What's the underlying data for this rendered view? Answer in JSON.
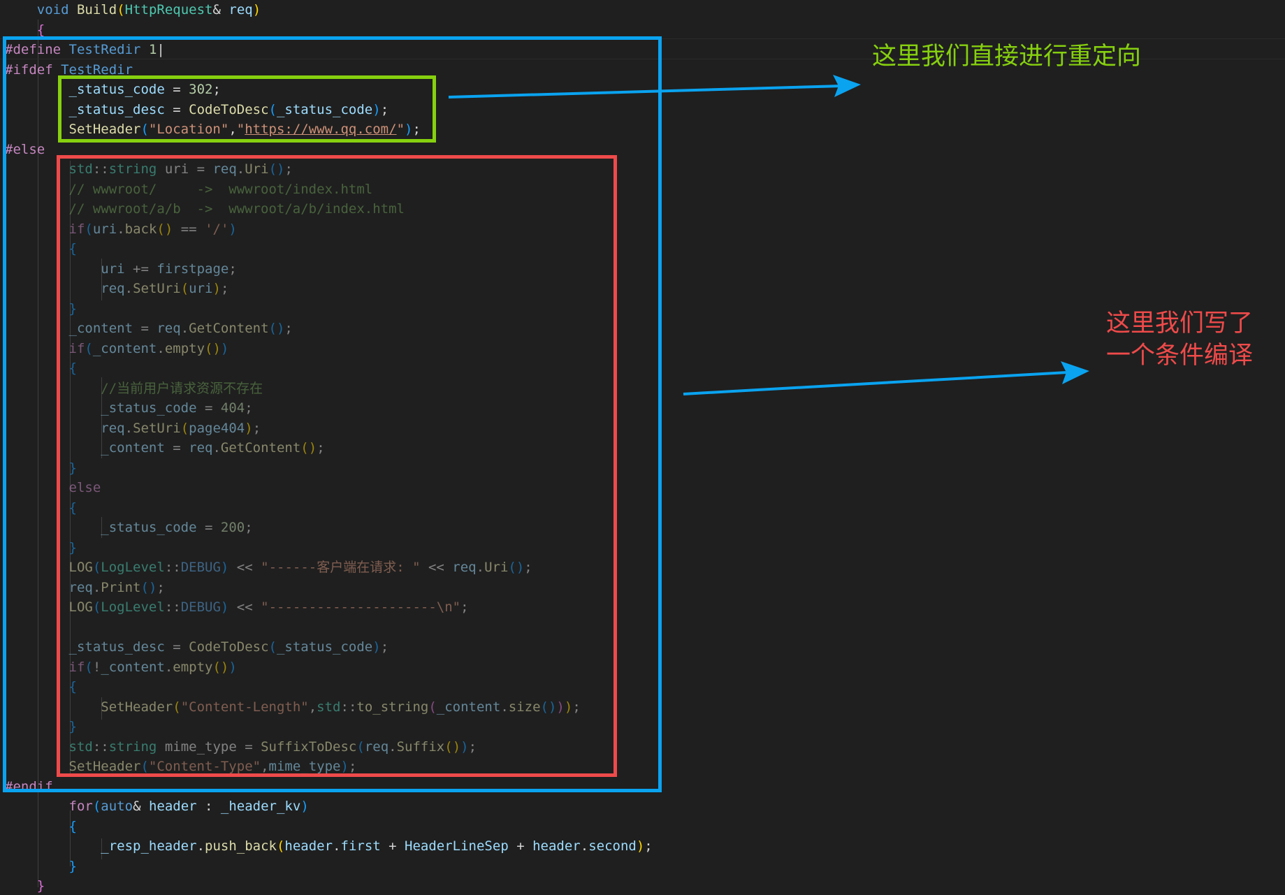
{
  "colors": {
    "annotation_blue": "#0aa3f0",
    "annotation_green": "#86d00f",
    "annotation_red": "#ef4a4a",
    "background": "#1f1f1f"
  },
  "annotations": {
    "green_note": "这里我们直接进行重定向",
    "red_note_line1": "这里我们写了",
    "red_note_line2": "一个条件编译"
  },
  "code": {
    "lines": [
      [
        [
          "    ",
          "plain"
        ],
        [
          "void",
          "kw"
        ],
        [
          " ",
          "plain"
        ],
        [
          "Build",
          "fn"
        ],
        [
          "(",
          "br1"
        ],
        [
          "HttpRequest",
          "type"
        ],
        [
          "& ",
          "plain"
        ],
        [
          "req",
          "var"
        ],
        [
          ")",
          "br1"
        ]
      ],
      [
        [
          "    ",
          "plain"
        ],
        [
          "{",
          "br2"
        ]
      ],
      [
        [
          "#define",
          "pp"
        ],
        [
          " ",
          "plain"
        ],
        [
          "TestRedir",
          "macro"
        ],
        [
          " ",
          "plain"
        ],
        [
          "1",
          "num"
        ],
        [
          "|",
          "plain"
        ]
      ],
      [
        [
          "#ifdef",
          "pp"
        ],
        [
          " ",
          "plain"
        ],
        [
          "TestRedir",
          "macro"
        ]
      ],
      [
        [
          "        ",
          "plain"
        ],
        [
          "_status_code",
          "var"
        ],
        [
          " = ",
          "plain"
        ],
        [
          "302",
          "num"
        ],
        [
          ";",
          "plain"
        ]
      ],
      [
        [
          "        ",
          "plain"
        ],
        [
          "_status_desc",
          "var"
        ],
        [
          " = ",
          "plain"
        ],
        [
          "CodeToDesc",
          "fn"
        ],
        [
          "(",
          "br3"
        ],
        [
          "_status_code",
          "var"
        ],
        [
          ")",
          "br3"
        ],
        [
          ";",
          "plain"
        ]
      ],
      [
        [
          "        ",
          "plain"
        ],
        [
          "SetHeader",
          "fn"
        ],
        [
          "(",
          "br3"
        ],
        [
          "\"Location\"",
          "str"
        ],
        [
          ",",
          "plain"
        ],
        [
          "\"",
          "str"
        ],
        [
          "https://www.qq.com/",
          "url"
        ],
        [
          "\"",
          "str"
        ],
        [
          ")",
          "br3"
        ],
        [
          ";",
          "plain"
        ]
      ],
      [
        [
          "#else",
          "pp"
        ]
      ],
      [
        [
          "        ",
          "plain"
        ],
        [
          "std",
          "type"
        ],
        [
          "::",
          "plain"
        ],
        [
          "string",
          "type"
        ],
        [
          " uri = ",
          "plain"
        ],
        [
          "req",
          "var"
        ],
        [
          ".",
          "plain"
        ],
        [
          "Uri",
          "fn"
        ],
        [
          "()",
          "br3"
        ],
        [
          ";",
          "plain"
        ]
      ],
      [
        [
          "        ",
          "plain"
        ],
        [
          "// wwwroot/     ->  wwwroot/index.html",
          "cmt"
        ]
      ],
      [
        [
          "        ",
          "plain"
        ],
        [
          "// wwwroot/a/b  ->  wwwroot/a/b/index.html",
          "cmt"
        ]
      ],
      [
        [
          "        ",
          "plain"
        ],
        [
          "if",
          "ctl"
        ],
        [
          "(",
          "br3"
        ],
        [
          "uri",
          "var"
        ],
        [
          ".",
          "plain"
        ],
        [
          "back",
          "fn"
        ],
        [
          "()",
          "br1"
        ],
        [
          " == ",
          "plain"
        ],
        [
          "'/'",
          "str"
        ],
        [
          ")",
          "br3"
        ]
      ],
      [
        [
          "        ",
          "plain"
        ],
        [
          "{",
          "br3"
        ]
      ],
      [
        [
          "            ",
          "plain"
        ],
        [
          "uri",
          "var"
        ],
        [
          " += ",
          "plain"
        ],
        [
          "firstpage",
          "var"
        ],
        [
          ";",
          "plain"
        ]
      ],
      [
        [
          "            ",
          "plain"
        ],
        [
          "req",
          "var"
        ],
        [
          ".",
          "plain"
        ],
        [
          "SetUri",
          "fn"
        ],
        [
          "(",
          "br1"
        ],
        [
          "uri",
          "var"
        ],
        [
          ")",
          "br1"
        ],
        [
          ";",
          "plain"
        ]
      ],
      [
        [
          "        ",
          "plain"
        ],
        [
          "}",
          "br3"
        ]
      ],
      [
        [
          "        ",
          "plain"
        ],
        [
          "_content",
          "var"
        ],
        [
          " = ",
          "plain"
        ],
        [
          "req",
          "var"
        ],
        [
          ".",
          "plain"
        ],
        [
          "GetContent",
          "fn"
        ],
        [
          "()",
          "br3"
        ],
        [
          ";",
          "plain"
        ]
      ],
      [
        [
          "        ",
          "plain"
        ],
        [
          "if",
          "ctl"
        ],
        [
          "(",
          "br3"
        ],
        [
          "_content",
          "var"
        ],
        [
          ".",
          "plain"
        ],
        [
          "empty",
          "fn"
        ],
        [
          "()",
          "br1"
        ],
        [
          ")",
          "br3"
        ]
      ],
      [
        [
          "        ",
          "plain"
        ],
        [
          "{",
          "br3"
        ]
      ],
      [
        [
          "            ",
          "plain"
        ],
        [
          "//当前用户请求资源不存在",
          "cmt"
        ]
      ],
      [
        [
          "            ",
          "plain"
        ],
        [
          "_status_code",
          "var"
        ],
        [
          " = ",
          "plain"
        ],
        [
          "404",
          "num"
        ],
        [
          ";",
          "plain"
        ]
      ],
      [
        [
          "            ",
          "plain"
        ],
        [
          "req",
          "var"
        ],
        [
          ".",
          "plain"
        ],
        [
          "SetUri",
          "fn"
        ],
        [
          "(",
          "br1"
        ],
        [
          "page404",
          "var"
        ],
        [
          ")",
          "br1"
        ],
        [
          ";",
          "plain"
        ]
      ],
      [
        [
          "            ",
          "plain"
        ],
        [
          "_content",
          "var"
        ],
        [
          " = ",
          "plain"
        ],
        [
          "req",
          "var"
        ],
        [
          ".",
          "plain"
        ],
        [
          "GetContent",
          "fn"
        ],
        [
          "()",
          "br1"
        ],
        [
          ";",
          "plain"
        ]
      ],
      [
        [
          "        ",
          "plain"
        ],
        [
          "}",
          "br3"
        ]
      ],
      [
        [
          "        ",
          "plain"
        ],
        [
          "else",
          "ctl"
        ]
      ],
      [
        [
          "        ",
          "plain"
        ],
        [
          "{",
          "br3"
        ]
      ],
      [
        [
          "            ",
          "plain"
        ],
        [
          "_status_code",
          "var"
        ],
        [
          " = ",
          "plain"
        ],
        [
          "200",
          "num"
        ],
        [
          ";",
          "plain"
        ]
      ],
      [
        [
          "        ",
          "plain"
        ],
        [
          "}",
          "br3"
        ]
      ],
      [
        [
          "        ",
          "plain"
        ],
        [
          "LOG",
          "fn"
        ],
        [
          "(",
          "br3"
        ],
        [
          "LogLevel",
          "type"
        ],
        [
          "::",
          "plain"
        ],
        [
          "DEBUG",
          "macro"
        ],
        [
          ")",
          "br3"
        ],
        [
          " << ",
          "plain"
        ],
        [
          "\"------客户端在请求: \"",
          "str"
        ],
        [
          " << ",
          "plain"
        ],
        [
          "req",
          "var"
        ],
        [
          ".",
          "plain"
        ],
        [
          "Uri",
          "fn"
        ],
        [
          "()",
          "br3"
        ],
        [
          ";",
          "plain"
        ]
      ],
      [
        [
          "        ",
          "plain"
        ],
        [
          "req",
          "var"
        ],
        [
          ".",
          "plain"
        ],
        [
          "Print",
          "fn"
        ],
        [
          "()",
          "br3"
        ],
        [
          ";",
          "plain"
        ]
      ],
      [
        [
          "        ",
          "plain"
        ],
        [
          "LOG",
          "fn"
        ],
        [
          "(",
          "br3"
        ],
        [
          "LogLevel",
          "type"
        ],
        [
          "::",
          "plain"
        ],
        [
          "DEBUG",
          "macro"
        ],
        [
          ")",
          "br3"
        ],
        [
          " << ",
          "plain"
        ],
        [
          "\"---------------------\\n\"",
          "str"
        ],
        [
          ";",
          "plain"
        ]
      ],
      [
        [
          "",
          "plain"
        ]
      ],
      [
        [
          "        ",
          "plain"
        ],
        [
          "_status_desc",
          "var"
        ],
        [
          " = ",
          "plain"
        ],
        [
          "CodeToDesc",
          "fn"
        ],
        [
          "(",
          "br3"
        ],
        [
          "_status_code",
          "var"
        ],
        [
          ")",
          "br3"
        ],
        [
          ";",
          "plain"
        ]
      ],
      [
        [
          "        ",
          "plain"
        ],
        [
          "if",
          "ctl"
        ],
        [
          "(",
          "br3"
        ],
        [
          "!",
          "plain"
        ],
        [
          "_content",
          "var"
        ],
        [
          ".",
          "plain"
        ],
        [
          "empty",
          "fn"
        ],
        [
          "()",
          "br1"
        ],
        [
          ")",
          "br3"
        ]
      ],
      [
        [
          "        ",
          "plain"
        ],
        [
          "{",
          "br3"
        ]
      ],
      [
        [
          "            ",
          "plain"
        ],
        [
          "SetHeader",
          "fn"
        ],
        [
          "(",
          "br1"
        ],
        [
          "\"Content-Length\"",
          "str"
        ],
        [
          ",",
          "plain"
        ],
        [
          "std",
          "type"
        ],
        [
          "::",
          "plain"
        ],
        [
          "to_string",
          "fn"
        ],
        [
          "(",
          "br2"
        ],
        [
          "_content",
          "var"
        ],
        [
          ".",
          "plain"
        ],
        [
          "size",
          "fn"
        ],
        [
          "()",
          "br3"
        ],
        [
          ")",
          "br2"
        ],
        [
          ")",
          "br1"
        ],
        [
          ";",
          "plain"
        ]
      ],
      [
        [
          "        ",
          "plain"
        ],
        [
          "}",
          "br3"
        ]
      ],
      [
        [
          "        ",
          "plain"
        ],
        [
          "std",
          "type"
        ],
        [
          "::",
          "plain"
        ],
        [
          "string",
          "type"
        ],
        [
          " mime_type = ",
          "plain"
        ],
        [
          "SuffixToDesc",
          "fn"
        ],
        [
          "(",
          "br3"
        ],
        [
          "req",
          "var"
        ],
        [
          ".",
          "plain"
        ],
        [
          "Suffix",
          "fn"
        ],
        [
          "()",
          "br1"
        ],
        [
          ")",
          "br3"
        ],
        [
          ";",
          "plain"
        ]
      ],
      [
        [
          "        ",
          "plain"
        ],
        [
          "SetHeader",
          "fn"
        ],
        [
          "(",
          "br3"
        ],
        [
          "\"Content-Type\"",
          "str"
        ],
        [
          ",",
          "plain"
        ],
        [
          "mime_type",
          "var"
        ],
        [
          ")",
          "br3"
        ],
        [
          ";",
          "plain"
        ]
      ],
      [
        [
          "#endif",
          "pp"
        ]
      ],
      [
        [
          "        ",
          "plain"
        ],
        [
          "for",
          "ctl"
        ],
        [
          "(",
          "br3"
        ],
        [
          "auto",
          "kw"
        ],
        [
          "& ",
          "plain"
        ],
        [
          "header",
          "var"
        ],
        [
          " : ",
          "plain"
        ],
        [
          "_header_kv",
          "var"
        ],
        [
          ")",
          "br3"
        ]
      ],
      [
        [
          "        ",
          "plain"
        ],
        [
          "{",
          "br3"
        ]
      ],
      [
        [
          "            ",
          "plain"
        ],
        [
          "_resp_header",
          "var"
        ],
        [
          ".",
          "plain"
        ],
        [
          "push_back",
          "fn"
        ],
        [
          "(",
          "br1"
        ],
        [
          "header",
          "var"
        ],
        [
          ".",
          "plain"
        ],
        [
          "first",
          "var"
        ],
        [
          " + ",
          "plain"
        ],
        [
          "HeaderLineSep",
          "var"
        ],
        [
          " + ",
          "plain"
        ],
        [
          "header",
          "var"
        ],
        [
          ".",
          "plain"
        ],
        [
          "second",
          "var"
        ],
        [
          ")",
          "br1"
        ],
        [
          ";",
          "plain"
        ]
      ],
      [
        [
          "        ",
          "plain"
        ],
        [
          "}",
          "br3"
        ]
      ],
      [
        [
          "    ",
          "plain"
        ],
        [
          "}",
          "br2"
        ]
      ]
    ]
  }
}
